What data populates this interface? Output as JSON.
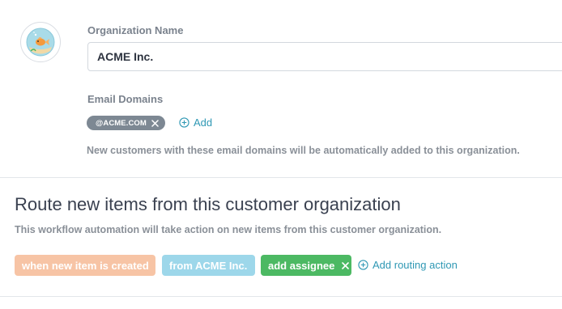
{
  "organization": {
    "name_label": "Organization Name",
    "name_value": "ACME Inc.",
    "email_domains_label": "Email Domains",
    "domains": [
      "@ACME.COM"
    ],
    "add_label": "Add",
    "helper_text": "New customers with these email domains will be automatically added to this organization.",
    "avatar_icon": "goldfish-bowl-icon"
  },
  "routing": {
    "title": "Route new items from this customer organization",
    "subtitle": "This workflow automation will take action on new items from this customer organization.",
    "trigger_label": "when new item is created",
    "condition_label": "from ACME Inc.",
    "action_label": "add assignee",
    "add_action_label": "Add routing action"
  },
  "colors": {
    "link": "#2f98b4",
    "trigger": "#f7c4a5",
    "condition": "#9dd7ea",
    "action": "#4cb963",
    "chip": "#7d8893"
  }
}
